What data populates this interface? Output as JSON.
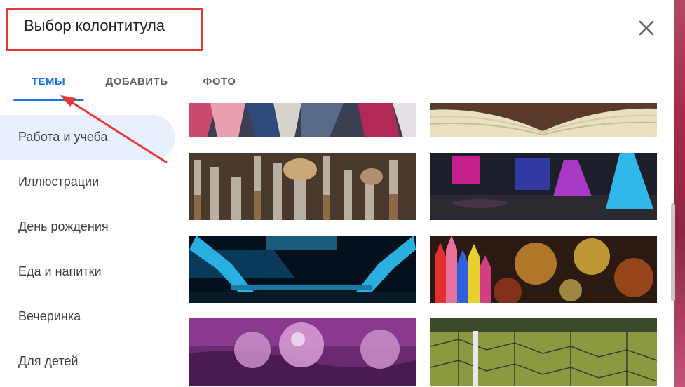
{
  "dialog": {
    "title": "Выбор колонтитула",
    "close_icon": "close-icon"
  },
  "tabs": [
    {
      "label": "ТЕМЫ",
      "active": true
    },
    {
      "label": "ДОБАВИТЬ",
      "active": false
    },
    {
      "label": "ФОТО",
      "active": false
    }
  ],
  "sidebar": {
    "items": [
      {
        "label": "Работа и учеба",
        "active": true
      },
      {
        "label": "Иллюстрации",
        "active": false
      },
      {
        "label": "День рождения",
        "active": false
      },
      {
        "label": "Еда и напитки",
        "active": false
      },
      {
        "label": "Вечеринка",
        "active": false
      },
      {
        "label": "Для детей",
        "active": false
      }
    ]
  },
  "themes": [
    {
      "name": "fabric"
    },
    {
      "name": "book"
    },
    {
      "name": "paint-brushes"
    },
    {
      "name": "chemistry-flasks"
    },
    {
      "name": "microscope"
    },
    {
      "name": "crayons-bokeh"
    },
    {
      "name": "water-drops"
    },
    {
      "name": "soccer-field"
    }
  ],
  "colors": {
    "accent": "#1a73e8",
    "highlight": "#e53935",
    "active_bg": "#e8f0fe"
  }
}
